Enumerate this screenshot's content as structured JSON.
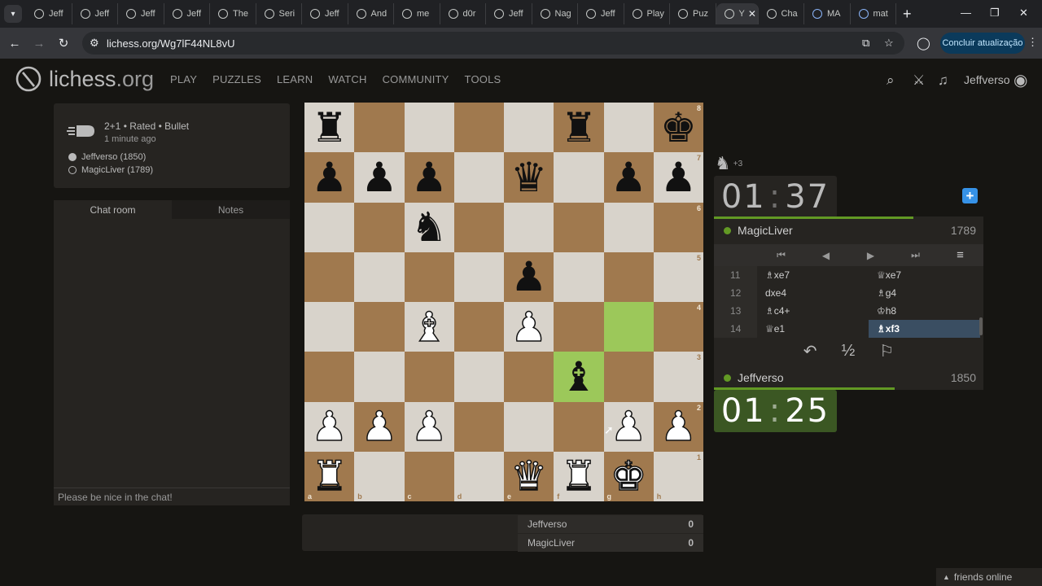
{
  "browser": {
    "tabs": [
      {
        "label": "Jeff",
        "favicon": "lichess-icon"
      },
      {
        "label": "Jeff",
        "favicon": "lichess-icon"
      },
      {
        "label": "Jeff",
        "favicon": "lichess-icon"
      },
      {
        "label": "Jeff",
        "favicon": "lichess-icon"
      },
      {
        "label": "The",
        "favicon": "lichess-icon"
      },
      {
        "label": "Seri",
        "favicon": "lichess-icon"
      },
      {
        "label": "Jeff",
        "favicon": "lichess-icon"
      },
      {
        "label": "And",
        "favicon": "lichess-icon"
      },
      {
        "label": "me",
        "favicon": "lichess-icon"
      },
      {
        "label": "d0r",
        "favicon": "lichess-icon"
      },
      {
        "label": "Jeff",
        "favicon": "lichess-icon"
      },
      {
        "label": "Nag",
        "favicon": "lichess-icon"
      },
      {
        "label": "Jeff",
        "favicon": "lichess-icon"
      },
      {
        "label": "Play",
        "favicon": "lichess-icon"
      },
      {
        "label": "Puz",
        "favicon": "lichess-icon"
      },
      {
        "label": "Y",
        "favicon": "audio-icon",
        "active": true
      },
      {
        "label": "Cha",
        "favicon": "chatgpt-icon"
      },
      {
        "label": "MA",
        "favicon": "google-icon"
      },
      {
        "label": "mat",
        "favicon": "google-icon"
      }
    ],
    "url": "lichess.org/Wg7lF44NL8vU",
    "update_label": "Concluir atualização"
  },
  "site": {
    "logo_main": "lichess",
    "logo_tld": ".org",
    "nav": [
      "PLAY",
      "PUZZLES",
      "LEARN",
      "WATCH",
      "COMMUNITY",
      "TOOLS"
    ],
    "username": "Jeffverso"
  },
  "game_info": {
    "mode": "2+1 • Rated • Bullet",
    "time_ago": "1 minute ago",
    "white_player": "Jeffverso (1850)",
    "black_player": "MagicLiver (1789)"
  },
  "chat": {
    "tab_chat": "Chat room",
    "tab_notes": "Notes",
    "placeholder": "Please be nice in the chat!"
  },
  "board": {
    "ranks": [
      "8",
      "7",
      "6",
      "5",
      "4",
      "3",
      "2",
      "1"
    ],
    "files": [
      "a",
      "b",
      "c",
      "d",
      "e",
      "f",
      "g",
      "h"
    ],
    "position": [
      [
        "bR",
        "",
        "",
        "",
        "",
        "bR",
        "",
        "bK"
      ],
      [
        "bP",
        "bP",
        "bP",
        "",
        "bQ",
        "",
        "bP",
        "bP"
      ],
      [
        "",
        "",
        "bN",
        "",
        "",
        "",
        "",
        ""
      ],
      [
        "",
        "",
        "",
        "",
        "bP",
        "",
        "",
        ""
      ],
      [
        "",
        "",
        "wB",
        "",
        "wP",
        "",
        "",
        ""
      ],
      [
        "",
        "",
        "",
        "",
        "",
        "bB",
        "",
        ""
      ],
      [
        "wP",
        "wP",
        "wP",
        "",
        "",
        "",
        "wP",
        "wP"
      ],
      [
        "wR",
        "",
        "",
        "",
        "wQ",
        "wR",
        "wK",
        ""
      ]
    ],
    "highlight": [
      "g4",
      "f3"
    ]
  },
  "score": {
    "rows": [
      {
        "name": "Jeffverso",
        "value": "0"
      },
      {
        "name": "MagicLiver",
        "value": "0"
      }
    ]
  },
  "material": {
    "diff": "+3"
  },
  "clock_top": {
    "min": "01",
    "sec": "37",
    "progress": 0.74
  },
  "clock_bottom": {
    "min": "01",
    "sec": "25",
    "progress": 0.67
  },
  "opponent": {
    "name": "MagicLiver",
    "rating": "1789"
  },
  "player": {
    "name": "Jeffverso",
    "rating": "1850"
  },
  "moves": [
    {
      "num": "11",
      "white": "♗xe7",
      "black": "♕xe7"
    },
    {
      "num": "12",
      "white": "dxe4",
      "black": "♗g4"
    },
    {
      "num": "13",
      "white": "♗c4+",
      "black": "♔h8"
    },
    {
      "num": "14",
      "white": "♕e1",
      "black": "♗xf3",
      "active": "black"
    }
  ],
  "actions": {
    "takeback": "↶",
    "draw": "½",
    "resign": "⚐"
  },
  "footer": {
    "friends": "friends online"
  }
}
